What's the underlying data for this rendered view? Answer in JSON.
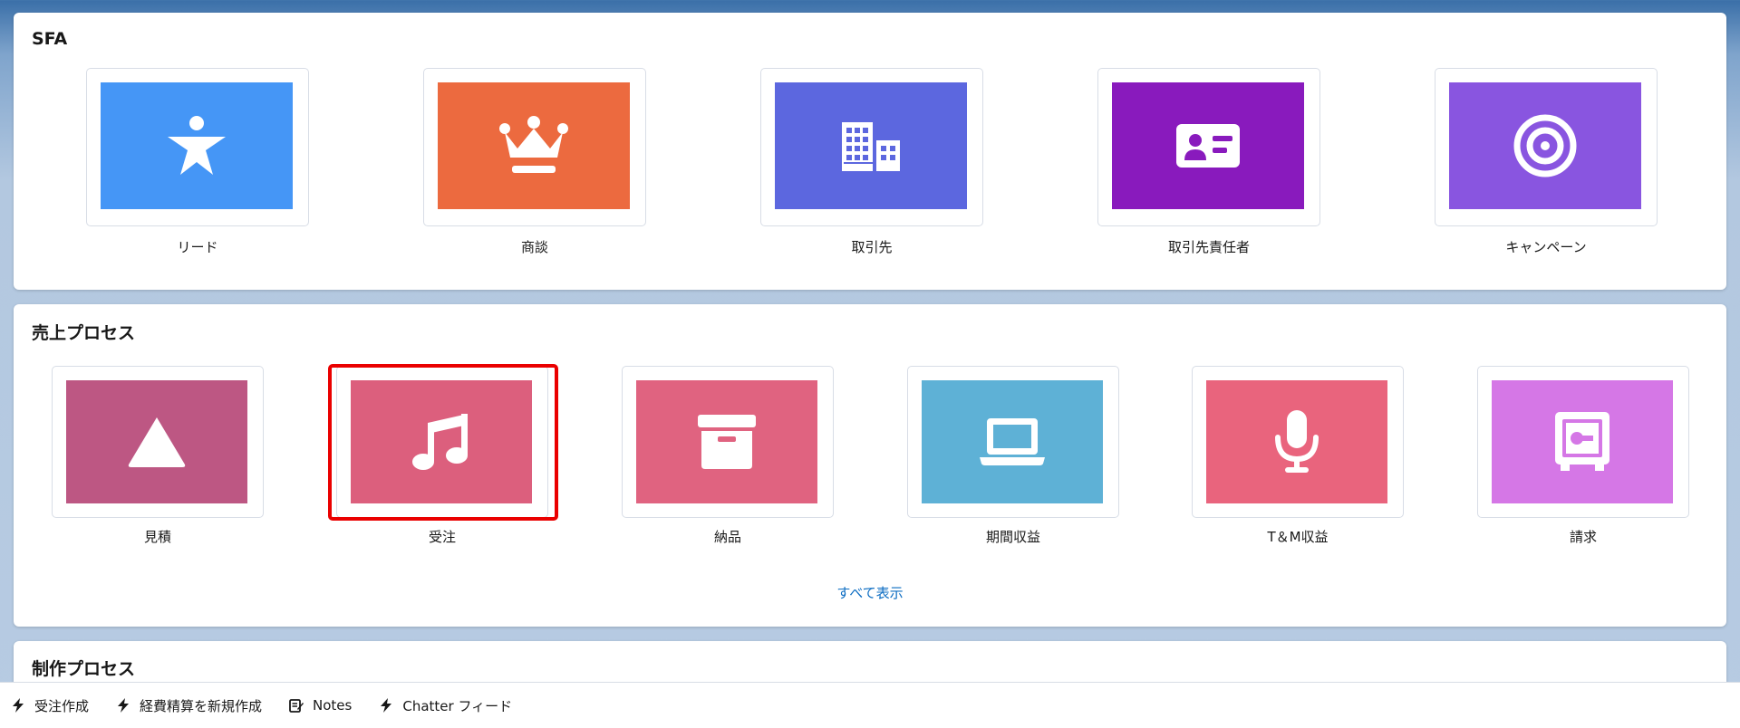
{
  "sections": {
    "sfa": {
      "title": "SFA",
      "tiles": [
        {
          "label": "リード",
          "color": "#4596f6",
          "icon": "lead-person-icon"
        },
        {
          "label": "商談",
          "color": "#ec6a3f",
          "icon": "opportunity-crown-icon"
        },
        {
          "label": "取引先",
          "color": "#5c67df",
          "icon": "account-building-icon"
        },
        {
          "label": "取引先責任者",
          "color": "#891abd",
          "icon": "contact-card-icon"
        },
        {
          "label": "キャンペーン",
          "color": "#8955e0",
          "icon": "campaign-target-icon"
        }
      ]
    },
    "sales_process": {
      "title": "売上プロセス",
      "tiles": [
        {
          "label": "見積",
          "color": "#bd5783",
          "icon": "quote-triangle-icon"
        },
        {
          "label": "受注",
          "color": "#dc5f7d",
          "icon": "order-music-note-icon",
          "selected": true
        },
        {
          "label": "納品",
          "color": "#e06380",
          "icon": "delivery-archive-box-icon"
        },
        {
          "label": "期間収益",
          "color": "#5eb1d6",
          "icon": "revenue-laptop-icon"
        },
        {
          "label": "T＆M収益",
          "color": "#e9647d",
          "icon": "tm-revenue-microphone-icon"
        },
        {
          "label": "請求",
          "color": "#d577e6",
          "icon": "invoice-safe-icon"
        }
      ],
      "view_all_label": "すべて表示"
    },
    "production_process": {
      "title": "制作プロセス"
    }
  },
  "utility_bar": {
    "items": [
      {
        "label": "受注作成",
        "icon": "lightning-bolt-icon"
      },
      {
        "label": "経費精算を新規作成",
        "icon": "lightning-bolt-icon"
      },
      {
        "label": "Notes",
        "icon": "notes-icon"
      },
      {
        "label": "Chatter フィード",
        "icon": "lightning-bolt-icon"
      }
    ]
  },
  "colors": {
    "selected_outline": "#ea0000",
    "link": "#0b6cc2"
  }
}
